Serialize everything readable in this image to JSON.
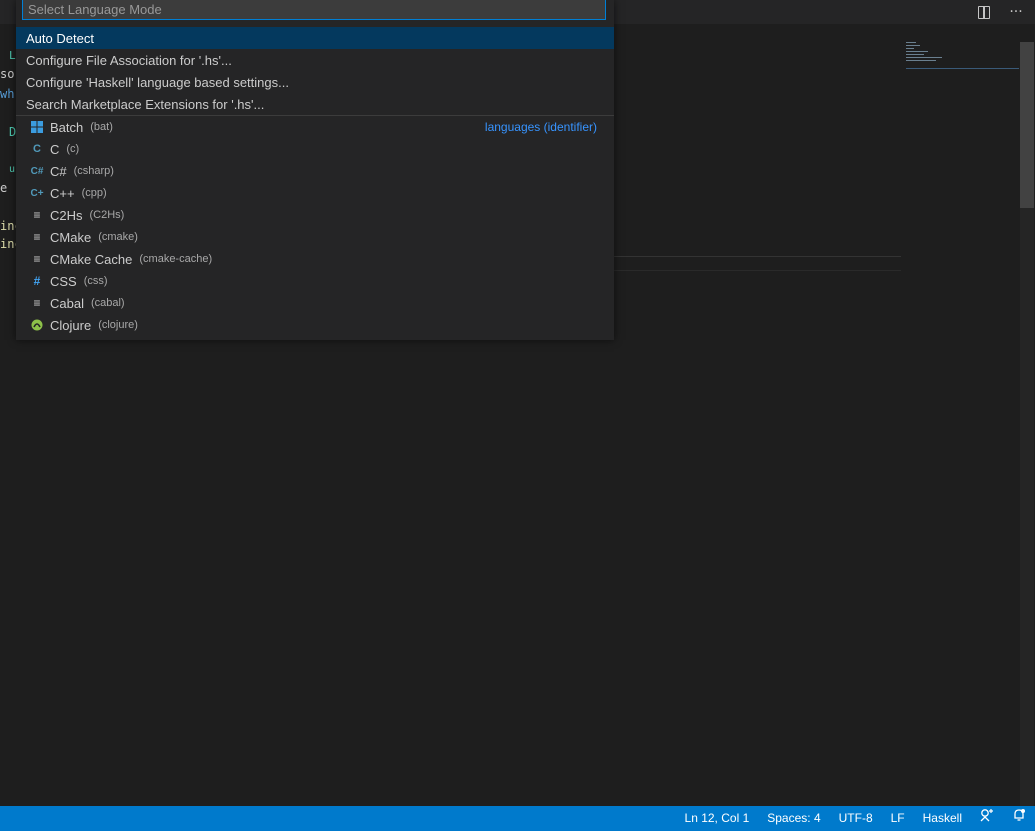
{
  "quick_input": {
    "placeholder": "Select Language Mode",
    "top_items": [
      "Auto Detect",
      "Configure File Association for '.hs'...",
      "Configure 'Haskell' language based settings...",
      "Search Marketplace Extensions for '.hs'..."
    ],
    "separator_label": "languages (identifier)",
    "languages": [
      {
        "name": "Batch",
        "id": "(bat)",
        "icon": "windows-icon"
      },
      {
        "name": "C",
        "id": "(c)",
        "icon": "c-icon"
      },
      {
        "name": "C#",
        "id": "(csharp)",
        "icon": "csharp-icon"
      },
      {
        "name": "C++",
        "id": "(cpp)",
        "icon": "cpp-icon"
      },
      {
        "name": "C2Hs",
        "id": "(C2Hs)",
        "icon": "lines-icon"
      },
      {
        "name": "CMake",
        "id": "(cmake)",
        "icon": "lines-icon"
      },
      {
        "name": "CMake Cache",
        "id": "(cmake-cache)",
        "icon": "lines-icon"
      },
      {
        "name": "CSS",
        "id": "(css)",
        "icon": "hash-icon"
      },
      {
        "name": "Cabal",
        "id": "(cabal)",
        "icon": "lines-icon"
      },
      {
        "name": "Clojure",
        "id": "(clojure)",
        "icon": "clojure-icon"
      }
    ]
  },
  "editor_actions": {
    "split": "split-editor-icon",
    "more": "···"
  },
  "code_fragments": [
    "L",
    "so",
    "wh",
    "D",
    "u",
    "e",
    "inc",
    "inc"
  ],
  "statusbar": {
    "position": "Ln 12, Col 1",
    "spaces": "Spaces: 4",
    "encoding": "UTF-8",
    "eol": "LF",
    "language": "Haskell"
  },
  "colors": {
    "accent": "#007acc",
    "focus_border": "#007fd4",
    "active_row": "#04395e",
    "separator_label": "#3794ff"
  }
}
